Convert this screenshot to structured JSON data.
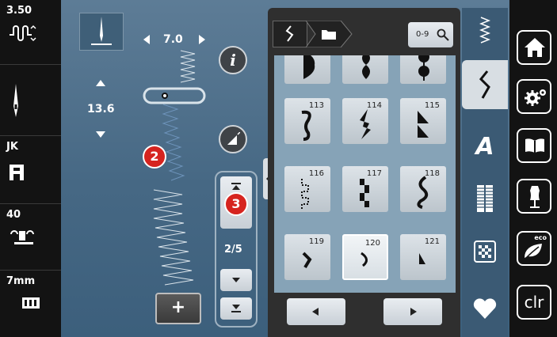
{
  "left_panel": {
    "stitch_width_value": "3.50",
    "needle_label": "",
    "presser_foot_label": "JK",
    "foot_pressure_value": "40",
    "feed_label": "7mm"
  },
  "stitch_edit": {
    "width_value": "7.0",
    "length_value": "13.6",
    "page_indicator": "2/5"
  },
  "callouts": {
    "badge_2": "2",
    "badge_3": "3"
  },
  "stitch_grid": {
    "header_search_label": "0-9",
    "tiles": [
      {
        "number": ""
      },
      {
        "number": ""
      },
      {
        "number": ""
      },
      {
        "number": "113"
      },
      {
        "number": "114"
      },
      {
        "number": "115"
      },
      {
        "number": "116"
      },
      {
        "number": "117"
      },
      {
        "number": "118"
      },
      {
        "number": "119"
      },
      {
        "number": "120"
      },
      {
        "number": "121"
      }
    ]
  },
  "right_panel": {
    "clr_label": "clr",
    "eco_label": "eco"
  },
  "colors": {
    "background": "#466884",
    "badge_red": "#d6241f",
    "panel_dark": "#131313"
  }
}
